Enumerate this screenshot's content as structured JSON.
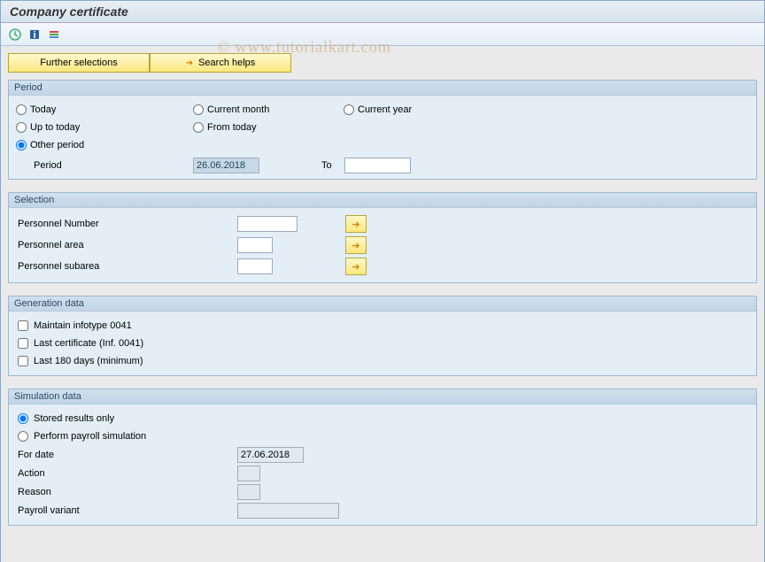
{
  "header": {
    "title": "Company certificate"
  },
  "watermark": "© www.tutorialkart.com",
  "buttons": {
    "further_selections": "Further selections",
    "search_helps": "Search helps"
  },
  "period": {
    "title": "Period",
    "today": "Today",
    "current_month": "Current month",
    "current_year": "Current year",
    "up_to_today": "Up to today",
    "from_today": "From today",
    "other_period": "Other period",
    "period_label": "Period",
    "period_from": "26.06.2018",
    "to_label": "To",
    "period_to": ""
  },
  "selection": {
    "title": "Selection",
    "rows": [
      {
        "label": "Personnel Number"
      },
      {
        "label": "Personnel area"
      },
      {
        "label": "Personnel subarea"
      }
    ]
  },
  "generation": {
    "title": "Generation data",
    "maintain_0041": "Maintain infotype 0041",
    "last_cert": "Last certificate (Inf. 0041)",
    "last_180": "Last 180 days (minimum)"
  },
  "simulation": {
    "title": "Simulation data",
    "stored_only": "Stored results only",
    "perform_sim": "Perform payroll simulation",
    "for_date_label": "For date",
    "for_date_value": "27.06.2018",
    "action_label": "Action",
    "reason_label": "Reason",
    "payroll_variant_label": "Payroll variant"
  }
}
